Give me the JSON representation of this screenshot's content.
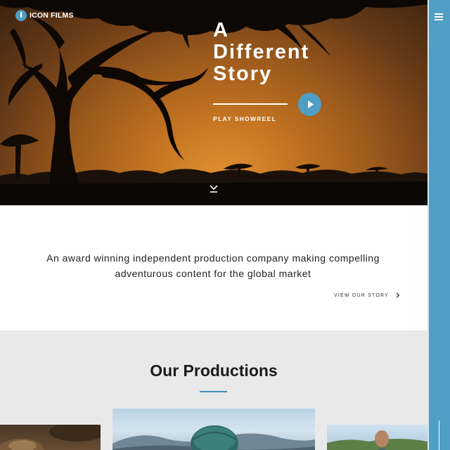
{
  "brand": {
    "name": "ICON FILMS",
    "mark": "I"
  },
  "hero": {
    "headline": [
      "A",
      "Different",
      "Story"
    ],
    "showreel_label": "PLAY SHOWREEL"
  },
  "intro": {
    "tagline": "An award winning independent production company making compelling adventurous content for the global market",
    "story_link": "VIEW OUR STORY"
  },
  "productions": {
    "title": "Our Productions"
  },
  "icons": {
    "play": "play-icon",
    "scroll": "scroll-down-icon",
    "menu": "hamburger-menu-icon",
    "chevron": "chevron-right-icon"
  },
  "colors": {
    "accent": "#4f9fc5",
    "sunset": "#c67622",
    "section_bg": "#e9e9e9"
  }
}
